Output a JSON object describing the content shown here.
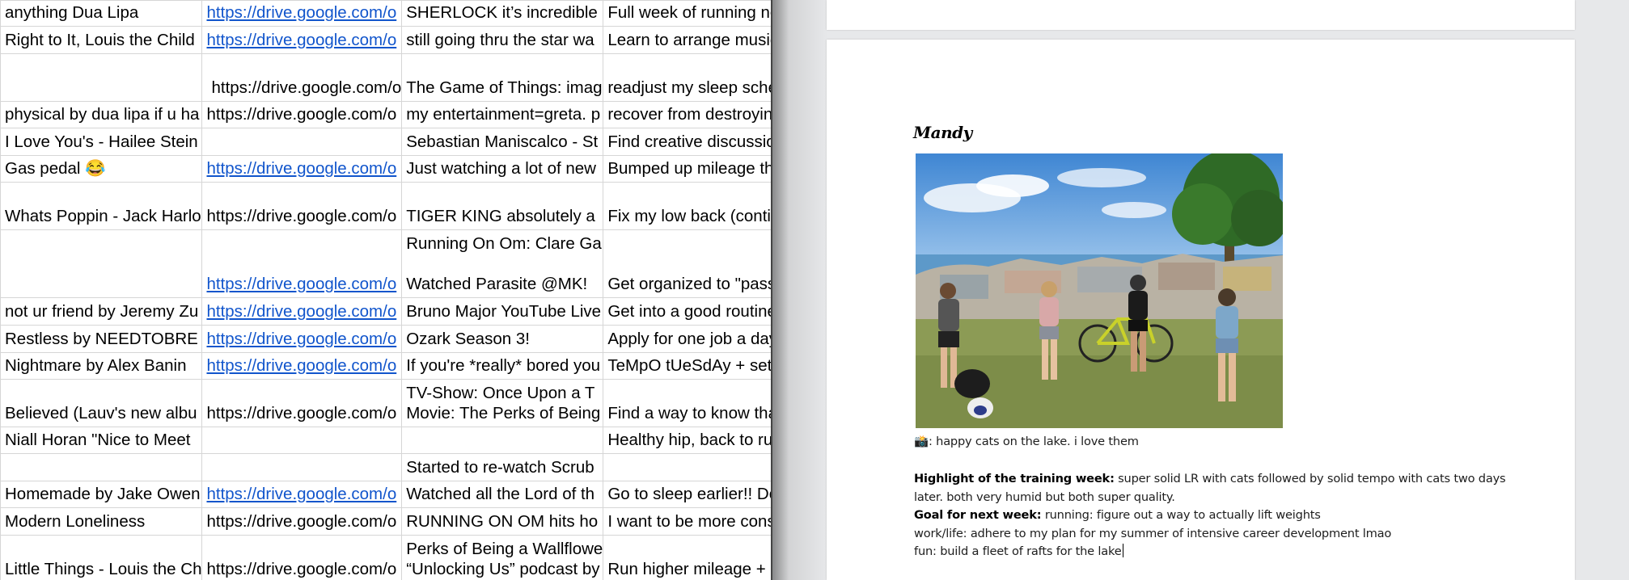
{
  "spreadsheet": {
    "rows": [
      {
        "cells": [
          {
            "text": "anything Dua Lipa"
          },
          {
            "text": "https://drive.google.com/o",
            "link": true
          },
          {
            "text": "SHERLOCK it’s incredible"
          },
          {
            "text": "Full week of running no sh"
          }
        ]
      },
      {
        "cells": [
          {
            "text": "Right to It, Louis the Child"
          },
          {
            "text": "https://drive.google.com/o",
            "link": true
          },
          {
            "text": "still going thru the star wa"
          },
          {
            "text": "Learn to arrange music, p"
          }
        ]
      },
      {
        "cells": [
          {
            "text": ""
          },
          {
            "text": "https://drive.google.com/o",
            "indent": true
          },
          {
            "text": "The Game of Things: imag"
          },
          {
            "text": "readjust my sleep schedu"
          }
        ]
      },
      {
        "cells": [
          {
            "text": "physical by dua lipa if u ha"
          },
          {
            "text": "https://drive.google.com/o"
          },
          {
            "text": "my entertainment=greta. p"
          },
          {
            "text": "recover from destroying m"
          }
        ]
      },
      {
        "cells": [
          {
            "text": "I Love You's - Hailee Stein"
          },
          {
            "text": ""
          },
          {
            "text": "Sebastian Maniscalco - St"
          },
          {
            "text": "Find creative discussion to"
          }
        ]
      },
      {
        "cells": [
          {
            "text": "Gas pedal 😂"
          },
          {
            "text": "https://drive.google.com/o",
            "link": true
          },
          {
            "text": "Just watching a lot of new"
          },
          {
            "text": "Bumped up mileage this w"
          }
        ]
      },
      {
        "cells": [
          {
            "text": "Whats Poppin - Jack Harlo"
          },
          {
            "text": "https://drive.google.com/o"
          },
          {
            "text": "TIGER KING absolutely a"
          },
          {
            "text": "Fix my low back (continue"
          }
        ]
      },
      {
        "cells": [
          {
            "text": ""
          },
          {
            "text": "https://drive.google.com/o",
            "link": true
          },
          {
            "text": "Running On Om: Clare Ga\n\nWatched Parasite @MK!"
          },
          {
            "text": "Get organized to \"pass\" m"
          }
        ]
      },
      {
        "cells": [
          {
            "text": "not ur friend by Jeremy Zu"
          },
          {
            "text": "https://drive.google.com/o",
            "link": true
          },
          {
            "text": "Bruno Major YouTube Live"
          },
          {
            "text": "Get into a good routine wit"
          }
        ]
      },
      {
        "cells": [
          {
            "text": "Restless by NEEDTOBRE"
          },
          {
            "text": "https://drive.google.com/o",
            "link": true
          },
          {
            "text": "Ozark Season 3!"
          },
          {
            "text": "Apply for one job a day #b"
          }
        ]
      },
      {
        "cells": [
          {
            "text": "Nightmare by Alex Banin"
          },
          {
            "text": "https://drive.google.com/o",
            "link": true
          },
          {
            "text": "If you're *really* bored you"
          },
          {
            "text": "TeMpO tUeSdAy + set a g"
          }
        ]
      },
      {
        "cells": [
          {
            "text": "Believed (Lauv's new albu"
          },
          {
            "text": "https://drive.google.com/o"
          },
          {
            "text": "TV-Show: Once Upon a T\nMovie: The Perks of Being"
          },
          {
            "text": "Find a way to know that ru"
          }
        ]
      },
      {
        "cells": [
          {
            "text": "Niall Horan \"Nice to Meet"
          },
          {
            "text": ""
          },
          {
            "text": ""
          },
          {
            "text": "Healthy hip, back to runnin"
          }
        ]
      },
      {
        "cells": [
          {
            "text": ""
          },
          {
            "text": ""
          },
          {
            "text": "Started to re-watch Scrub"
          },
          {
            "text": ""
          }
        ]
      },
      {
        "cells": [
          {
            "text": "Homemade by Jake Owen"
          },
          {
            "text": "https://drive.google.com/o",
            "link": true
          },
          {
            "text": "Watched all the Lord of th"
          },
          {
            "text": "Go to sleep earlier!! Don't"
          }
        ]
      },
      {
        "cells": [
          {
            "text": "Modern Loneliness"
          },
          {
            "text": "https://drive.google.com/o"
          },
          {
            "text": "RUNNING ON OM hits ho"
          },
          {
            "text": "I want to be more conscio"
          }
        ]
      },
      {
        "cells": [
          {
            "text": "Little Things - Louis the Ch"
          },
          {
            "text": "https://drive.google.com/o"
          },
          {
            "text": "Perks of Being a Wallflowe\n“Unlocking Us” podcast by"
          },
          {
            "text": "Run higher mileage + get"
          }
        ]
      }
    ]
  },
  "document": {
    "name": "Mandy",
    "photo": {
      "subject": "four people with bicycles on grass by the lake"
    },
    "caption": {
      "icon": "📸",
      "text": ": happy cats on the lake. i love them"
    },
    "highlight": {
      "label": "Highlight of the training week:",
      "text": " super solid LR with cats followed by solid tempo with cats two days"
    },
    "highlight_cont": "later. both very humid but both super quality.",
    "goal": {
      "label": "Goal for next week:",
      "text": " running: figure out a way to actually lift weights"
    },
    "work_life": "work/life: adhere to my plan for my summer of intensive career development lmao",
    "fun": "fun: build a fleet of rafts for the lake"
  }
}
